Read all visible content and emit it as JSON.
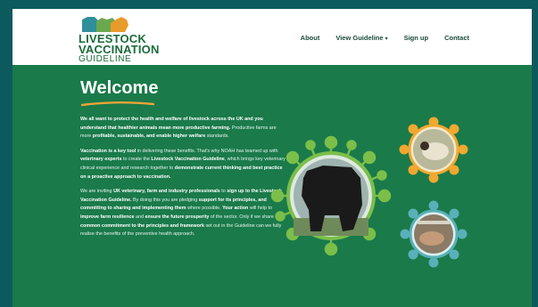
{
  "brand": {
    "line1": "LIVESTOCK",
    "line2": "VACCINATION",
    "line3": "GUIDELINE",
    "colors": {
      "teal": "#2f8f9a",
      "green": "#6aa84f",
      "orange": "#e89a2a",
      "dark_green": "#1b6b3a"
    }
  },
  "nav": {
    "about": "About",
    "view_guideline": "View Guideline",
    "caret": "▾",
    "sign_up": "Sign up",
    "contact": "Contact"
  },
  "page": {
    "title": "Welcome",
    "p1": {
      "a": "We all want to protect the health and welfare of livestock across the UK and you understand that ",
      "b": "healthier animals mean more productive farming.",
      "c": " Productive farms are more ",
      "d": "profitable, sustainable, and enable higher welfare",
      "e": " standards."
    },
    "p2": {
      "a": "Vaccination is a key tool",
      "b": " in delivering these benefits. That's why NOAH has teamed up with ",
      "c": "veterinary experts",
      "d": " to create the ",
      "e": "Livestock Vaccination Guideline",
      "f": ", which brings key veterinary clinical experience and research together to ",
      "g": "demonstrate current thinking and best practice on a proactive approach to vaccination."
    },
    "p3": {
      "a": "We are inviting ",
      "b": "UK veterinary, farm and industry professionals",
      "c": " to ",
      "d": "sign up to the Livestock Vaccination Guideline.",
      "e": " By doing this you are pledging ",
      "f": "support for its principles, and committing to sharing and implementing them",
      "g": " where possible. ",
      "h": "Your action",
      "i": " will help to ",
      "j": "improve farm resilience",
      "k": " and ",
      "l": "ensure the future prosperity",
      "m": " of the sector. Only if we share a ",
      "n": "common commitment to the principles and framework",
      "o": " set out in the Guideline can we fully realise the benefits of the preventive health approach."
    }
  },
  "accent_colors": {
    "underline": "#e8a33a",
    "ring_green": "#7bbf4a",
    "ring_orange": "#f0a830",
    "ring_teal": "#5ab0b8"
  }
}
